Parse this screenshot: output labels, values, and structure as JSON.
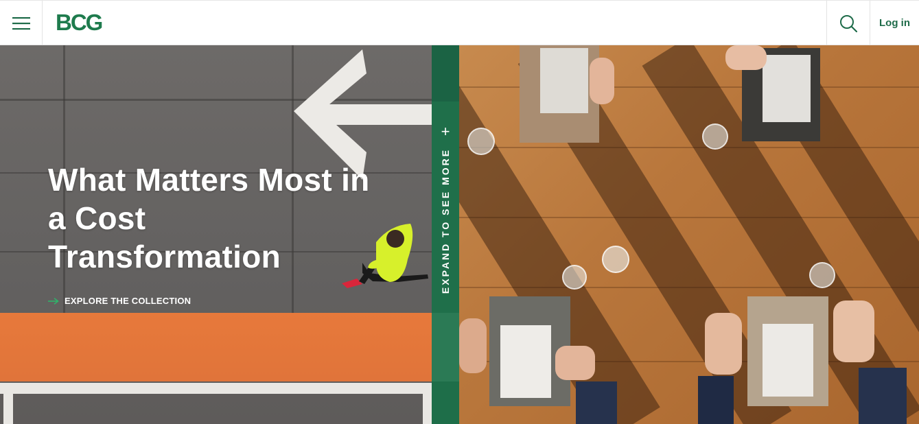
{
  "header": {
    "logo_text": "BCG",
    "menu_icon": "hamburger-menu-icon",
    "search_icon": "search-icon",
    "login_label": "Log in"
  },
  "hero": {
    "title": "What Matters Most in a Cost Transformation",
    "link_label": "EXPLORE THE COLLECTION",
    "link_icon": "arrow-right-icon"
  },
  "expand": {
    "label": "EXPAND TO SEE MORE",
    "icon": "plus-icon"
  },
  "colors": {
    "brand_green": "#1e7b4d",
    "expand_bar": "#1f6f4a",
    "link_arrow": "#2fb36a"
  }
}
